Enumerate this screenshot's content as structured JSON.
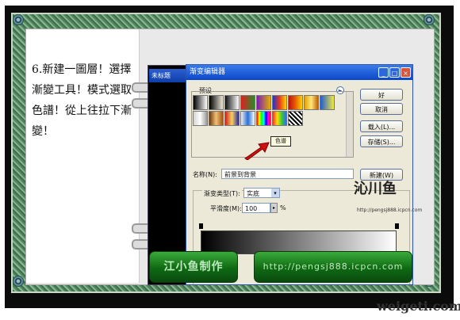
{
  "instruction": {
    "text": "6.新建一圖層！選擇漸變工具！模式選取色譜！從上往拉下漸變！"
  },
  "photoshop_doc": {
    "title": "未标题"
  },
  "dialog": {
    "title": "渐变编辑器",
    "controls": {
      "minimize": "_",
      "maximize": "□",
      "close": "×"
    },
    "presets": {
      "label": "预设",
      "menu_icon": "►"
    },
    "tooltip": "色谱",
    "buttons": {
      "ok": "好",
      "cancel": "取消",
      "load": "载入(L)...",
      "save": "存储(S)...",
      "new": "新建(W)"
    },
    "name": {
      "label": "名称(N):",
      "value": "前景到背景"
    },
    "gradient_type": {
      "label": "渐变类型(T):",
      "value": "实底"
    },
    "smoothness": {
      "label": "平滑度(M):",
      "value": "100",
      "unit": "%"
    },
    "swatches": [
      "linear-gradient(90deg,#000,#fff)",
      "linear-gradient(90deg,#000,rgba(0,0,0,0))",
      "linear-gradient(90deg,#111,#fff)",
      "linear-gradient(90deg,#e02020,#2a8a2a)",
      "linear-gradient(90deg,#7a1cb8,#e3b000)",
      "linear-gradient(90deg,#1d37c9,#e73a1a,#ffd700)",
      "linear-gradient(90deg,#c01010,#e65d00,#ffd400)",
      "linear-gradient(90deg,#e6a100,#ffe67a,#c06000)",
      "linear-gradient(90deg,#1f5bd4,#f2e840)",
      "linear-gradient(90deg,#d4d4d4,#fff,#9a9a9a)",
      "linear-gradient(90deg,#6b3b14,#f0c070,#a0541a)",
      "linear-gradient(90deg,#d02020,#f6d060,#2a2aa0)",
      "linear-gradient(90deg,#f0f0f0,#2a6fd6,#fff)",
      "linear-gradient(90deg,#ff0000,#ffff00,#00ff00,#00ffff,#0000ff,#ff00ff,#ff0000)",
      "linear-gradient(90deg,#e33,#fd0,#3c3,#36f)",
      "repeating-linear-gradient(45deg,#000 0 2px,#fff 2px 4px)"
    ]
  },
  "banners": {
    "left": "江小鱼制作",
    "right": "http://pengsj888.icpcn.com"
  },
  "watermarks": {
    "side": "沁川鱼",
    "side_sub": "http://pengsj888.icpcn.com",
    "bottom": "weigeti.com"
  }
}
